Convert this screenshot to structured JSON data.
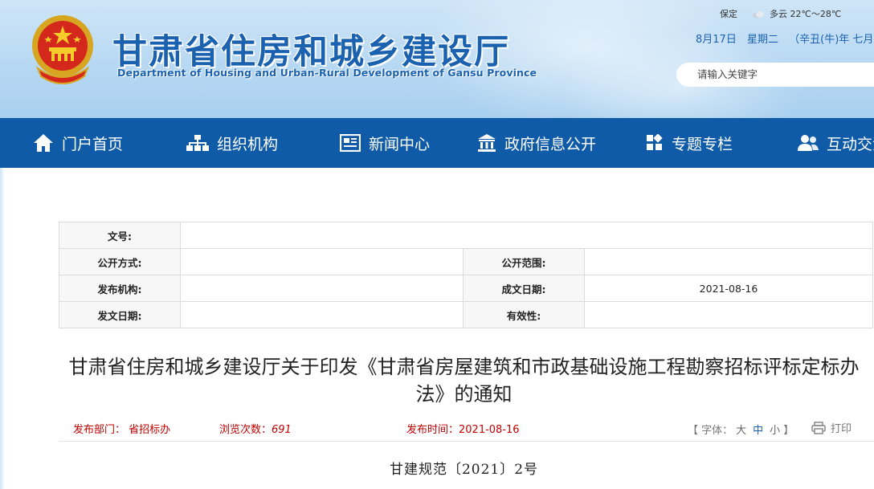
{
  "header": {
    "title": "甘肃省住房和城乡建设厅",
    "subtitle": "Department of Housing and Urban-Rural Development of Gansu Province",
    "weather": {
      "city": "保定",
      "condition": "多云",
      "temp": "22℃～28℃",
      "icon": "cloudy-icon"
    },
    "date": {
      "day": "8月17日",
      "weekday": "星期二",
      "lunar": "（辛丑(牛)年 七月十"
    },
    "search_placeholder": "请输入关键字",
    "colors": {
      "brand": "#1a62b0",
      "nav": "#0f5ba7"
    }
  },
  "nav": [
    {
      "label": "门户首页",
      "icon": "home-icon"
    },
    {
      "label": "组织机构",
      "icon": "org-chart-icon"
    },
    {
      "label": "新闻中心",
      "icon": "newspaper-icon"
    },
    {
      "label": "政府信息公开",
      "icon": "government-building-icon"
    },
    {
      "label": "专题专栏",
      "icon": "grid-icon"
    },
    {
      "label": "互动交流",
      "icon": "users-icon"
    }
  ],
  "info_table": {
    "doc_no_label": "文号:",
    "doc_no_value": "",
    "disclosure_method_label": "公开方式:",
    "disclosure_method_value": "",
    "disclosure_scope_label": "公开范围:",
    "disclosure_scope_value": "",
    "publisher_label": "发布机构:",
    "publisher_value": "",
    "written_date_label": "成文日期:",
    "written_date_value": "2021-08-16",
    "issue_date_label": "发文日期:",
    "issue_date_value": "",
    "validity_label": "有效性:",
    "validity_value": ""
  },
  "article": {
    "title": "甘肃省住房和城乡建设厅关于印发《甘肃省房屋建筑和市政基础设施工程勘察招标评标定标办法》的通知",
    "dept_label": "发布部门：",
    "dept_value": "省招标办",
    "views_label": "浏览次数：",
    "views_value": "691",
    "publish_time_label": "发布时间：",
    "publish_time_value": "2021-08-16",
    "font_label_open": "【 字体：",
    "font_large": "大",
    "font_medium": "中",
    "font_small": "小",
    "font_label_close": "】",
    "print_label": "打印",
    "doc_number": "甘建规范〔2021〕2号",
    "meta_color": "#c00000"
  }
}
